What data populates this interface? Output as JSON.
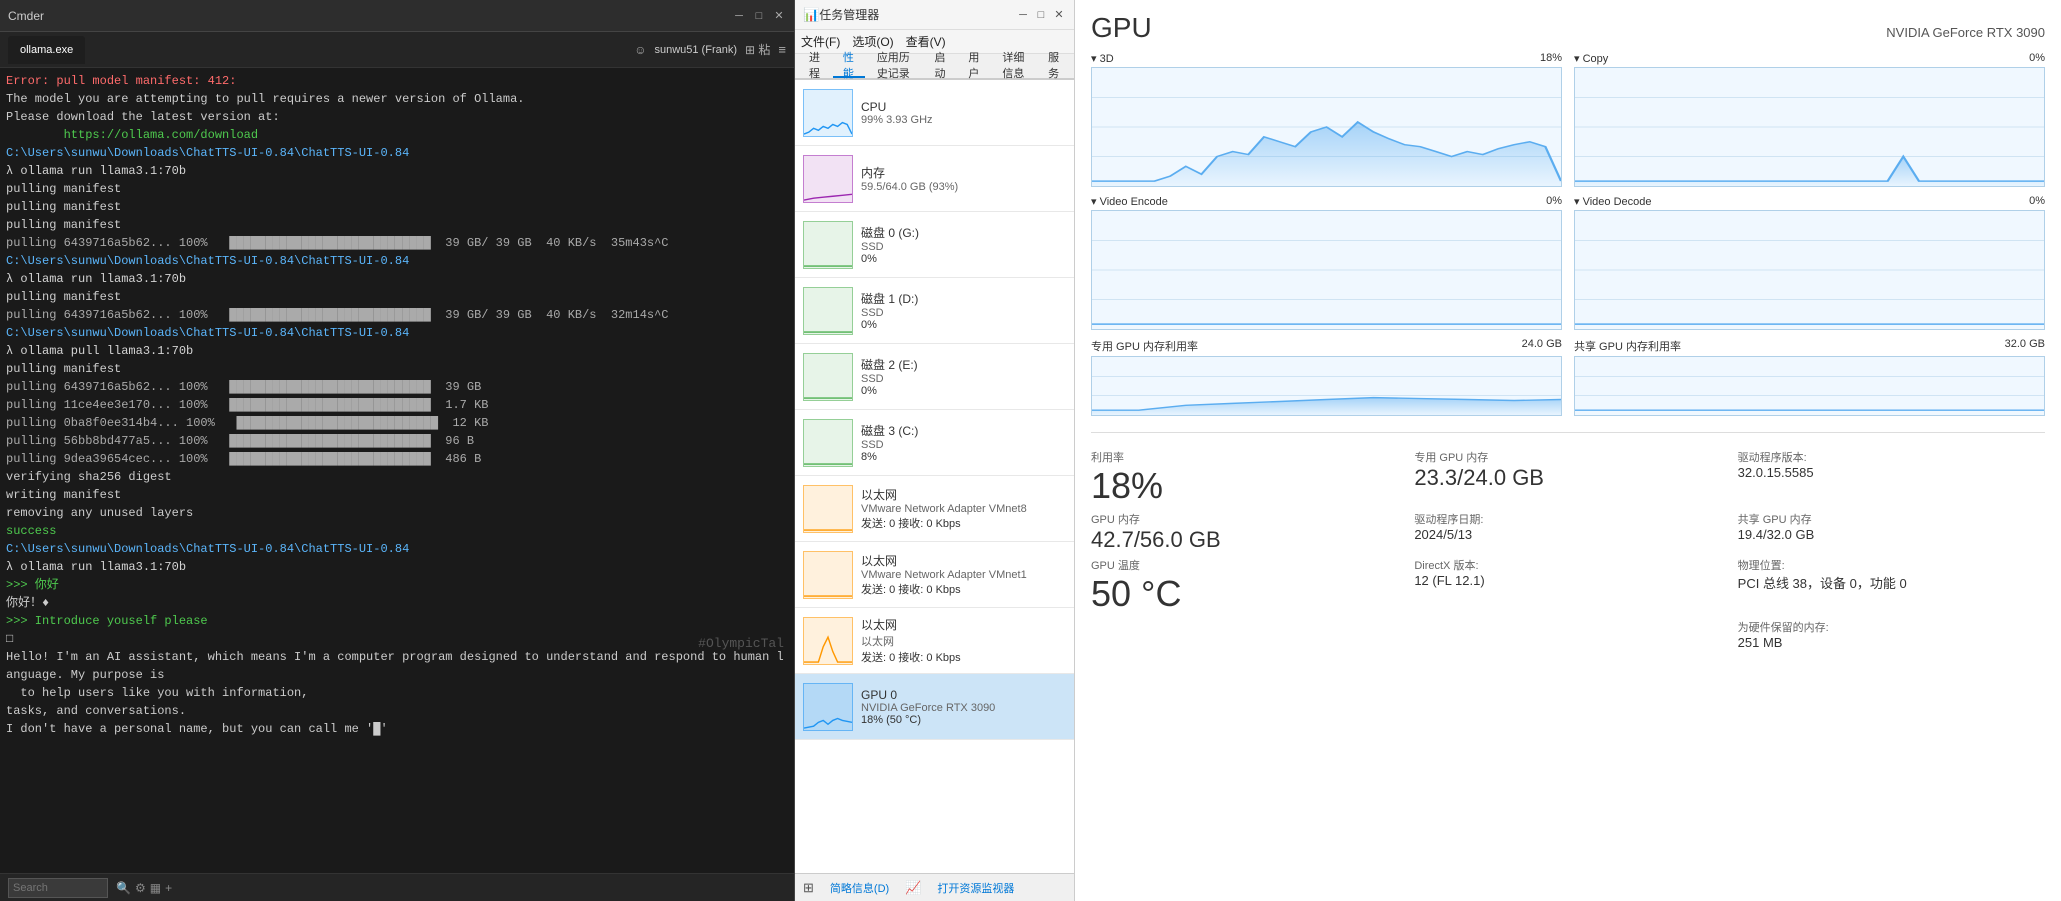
{
  "terminal": {
    "title": "Cmder",
    "tab_label": "ollama.exe",
    "lines": [
      {
        "text": "Error: pull model manifest: 412:",
        "class": "error"
      },
      {
        "text": "",
        "class": ""
      },
      {
        "text": "The model you are attempting to pull requires a newer version of Ollama.",
        "class": ""
      },
      {
        "text": "",
        "class": ""
      },
      {
        "text": "Please download the latest version at:",
        "class": ""
      },
      {
        "text": "",
        "class": ""
      },
      {
        "text": "        https://ollama.com/download",
        "class": "green"
      },
      {
        "text": "",
        "class": ""
      },
      {
        "text": "",
        "class": ""
      },
      {
        "text": "C:\\Users\\sunwu\\Downloads\\ChatTTS-UI-0.84\\ChatTTS-UI-0.84",
        "class": "path"
      },
      {
        "text": "λ ollama run llama3.1:70b",
        "class": "lambda"
      },
      {
        "text": "pulling manifest",
        "class": ""
      },
      {
        "text": "pulling manifest",
        "class": ""
      },
      {
        "text": "pulling manifest",
        "class": ""
      },
      {
        "text": "pulling 6439716a5b62... 100%   ████████████████████████████  39 GB/ 39 GB  40 KB/s  35m43s^C",
        "class": "progress"
      },
      {
        "text": "C:\\Users\\sunwu\\Downloads\\ChatTTS-UI-0.84\\ChatTTS-UI-0.84",
        "class": "path"
      },
      {
        "text": "λ ollama run llama3.1:70b",
        "class": "lambda"
      },
      {
        "text": "pulling manifest",
        "class": ""
      },
      {
        "text": "pulling 6439716a5b62... 100%   ████████████████████████████  39 GB/ 39 GB  40 KB/s  32m14s^C",
        "class": "progress"
      },
      {
        "text": "C:\\Users\\sunwu\\Downloads\\ChatTTS-UI-0.84\\ChatTTS-UI-0.84",
        "class": "path"
      },
      {
        "text": "λ ollama pull llama3.1:70b",
        "class": "lambda"
      },
      {
        "text": "pulling manifest",
        "class": ""
      },
      {
        "text": "pulling 6439716a5b62... 100%   ████████████████████████████  39 GB",
        "class": "progress"
      },
      {
        "text": "pulling 11ce4ee3e170... 100%   ████████████████████████████  1.7 KB",
        "class": "progress"
      },
      {
        "text": "pulling 0ba8f0ee314b4... 100%   ████████████████████████████  12 KB",
        "class": "progress"
      },
      {
        "text": "pulling 56bb8bd477a5... 100%   ████████████████████████████  96 B",
        "class": "progress"
      },
      {
        "text": "pulling 9dea39654cec... 100%   ████████████████████████████  486 B",
        "class": "progress"
      },
      {
        "text": "verifying sha256 digest",
        "class": ""
      },
      {
        "text": "writing manifest",
        "class": ""
      },
      {
        "text": "removing any unused layers",
        "class": ""
      },
      {
        "text": "success",
        "class": "green"
      },
      {
        "text": "",
        "class": ""
      },
      {
        "text": "C:\\Users\\sunwu\\Downloads\\ChatTTS-UI-0.84\\ChatTTS-UI-0.84",
        "class": "path"
      },
      {
        "text": "λ ollama run llama3.1:70b",
        "class": "lambda"
      },
      {
        "text": ">>> 你好",
        "class": "green"
      },
      {
        "text": "你好！♦",
        "class": ""
      },
      {
        "text": "",
        "class": ""
      },
      {
        "text": ">>> Introduce youself please",
        "class": "green"
      },
      {
        "text": "□",
        "class": ""
      },
      {
        "text": "",
        "class": ""
      },
      {
        "text": "Hello! I'm an AI assistant, which means I'm a computer program designed to understand and respond to human language. My purpose is",
        "class": ""
      },
      {
        "text": "  to help users like you with information,",
        "class": ""
      },
      {
        "text": "tasks, and conversations.",
        "class": ""
      },
      {
        "text": "",
        "class": ""
      },
      {
        "text": "I don't have a personal name, but you can call me '█'",
        "class": ""
      }
    ],
    "watermark": "#OlympicTal",
    "search_placeholder": "Search"
  },
  "taskmgr": {
    "title": "任务管理器",
    "menu_items": [
      "文件(F)",
      "选项(O)",
      "查看(V)"
    ],
    "tabs": [
      "进程",
      "性能",
      "应用历史记录",
      "启动",
      "用户",
      "详细信息",
      "服务"
    ],
    "active_tab": "性能",
    "resources": [
      {
        "name": "CPU",
        "sub": "99% 3.93 GHz",
        "color": "#2196F3",
        "graph_color": "#2196F3"
      },
      {
        "name": "内存",
        "sub": "59.5/64.0 GB (93%)",
        "color": "#9C27B0",
        "graph_color": "#9C27B0"
      },
      {
        "name": "磁盘 0 (G:)",
        "sub": "SSD",
        "val": "0%",
        "color": "#4CAF50",
        "graph_color": "#4CAF50"
      },
      {
        "name": "磁盘 1 (D:)",
        "sub": "SSD",
        "val": "0%",
        "color": "#4CAF50",
        "graph_color": "#4CAF50"
      },
      {
        "name": "磁盘 2 (E:)",
        "sub": "SSD",
        "val": "0%",
        "color": "#4CAF50",
        "graph_color": "#4CAF50"
      },
      {
        "name": "磁盘 3 (C:)",
        "sub": "SSD",
        "val": "8%",
        "color": "#4CAF50",
        "graph_color": "#4CAF50"
      },
      {
        "name": "以太网",
        "sub": "VMware Network Adapter VMnet8",
        "val": "发送: 0 接收: 0 Kbps",
        "color": "#FF9800",
        "graph_color": "#FF9800"
      },
      {
        "name": "以太网",
        "sub": "VMware Network Adapter VMnet1",
        "val": "发送: 0 接收: 0 Kbps",
        "color": "#FF9800",
        "graph_color": "#FF9800"
      },
      {
        "name": "以太网",
        "sub": "以太网",
        "val": "发送: 0 接收: 0 Kbps",
        "color": "#FF9800",
        "graph_color": "#FF9800",
        "has_activity": true
      },
      {
        "name": "GPU 0",
        "sub": "NVIDIA GeForce RTX 3090",
        "val": "18% (50 °C)",
        "color": "#2196F3",
        "graph_color": "#2196F3",
        "selected": true
      }
    ],
    "bottombar": {
      "summary_link": "简略信息(D)",
      "resource_link": "打开资源监视器"
    }
  },
  "gpu_detail": {
    "title": "GPU",
    "model": "NVIDIA GeForce RTX 3090",
    "sections": [
      {
        "label": "3D",
        "pct": "18%",
        "type": "graph"
      },
      {
        "label": "Copy",
        "pct": "0%",
        "type": "graph"
      }
    ],
    "sections2": [
      {
        "label": "Video Encode",
        "pct": "0%",
        "type": "graph"
      },
      {
        "label": "Video Decode",
        "pct": "0%",
        "type": "graph"
      }
    ],
    "mem_sections": [
      {
        "label": "专用 GPU 内存利用率",
        "max": "24.0 GB"
      },
      {
        "label": "共享 GPU 内存利用率",
        "max": "32.0 GB"
      }
    ],
    "stats": {
      "utilization_label": "利用率",
      "utilization_value": "18%",
      "dedicated_mem_label": "专用 GPU 内存",
      "dedicated_mem_value": "23.3/24.0 GB",
      "driver_version_label": "驱动程序版本:",
      "driver_version_value": "32.0.15.5585",
      "gpu_mem_label": "GPU 内存",
      "gpu_mem_value": "42.7/56.0 GB",
      "driver_date_label": "驱动程序日期:",
      "driver_date_value": "2024/5/13",
      "shared_mem_label": "共享 GPU 内存",
      "shared_mem_value": "19.4/32.0 GB",
      "directx_label": "DirectX 版本:",
      "directx_value": "12 (FL 12.1)",
      "hardware_label": "物理位置:",
      "hardware_value": "PCI 总线 38，设备 0，功能 0",
      "reserved_mem_label": "为硬件保留的内存:",
      "reserved_mem_value": "251 MB",
      "temp_label": "GPU 温度",
      "temp_value": "50 °C"
    }
  }
}
